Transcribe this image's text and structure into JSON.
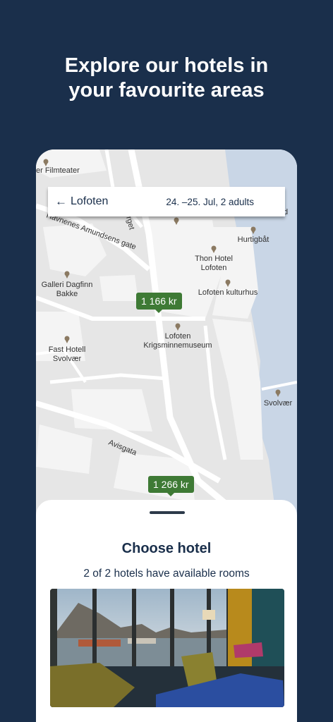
{
  "headline": {
    "line1": "Explore our hotels in",
    "line2": "your favourite areas"
  },
  "search_bar": {
    "back_icon": "arrow-left-icon",
    "location": "Lofoten",
    "dates_guests": "24. –25. Jul, 2 adults"
  },
  "map": {
    "street_labels": [
      "er Filmteater",
      "Havnenes Amundsens gate",
      "rget",
      "Avisgata",
      "d"
    ],
    "poi_labels": [
      "Hurtigbåt",
      "Thon Hotel",
      "Lofoten",
      "Galleri Dagfinn",
      "Bakke",
      "Lofoten kulturhus",
      "Lofoten",
      "Krigsminnemuseum",
      "Fast Hotell",
      "Svolvær",
      "Svolvær"
    ],
    "price_tags": [
      "1 166 kr",
      "1 266 kr"
    ],
    "colors": {
      "land": "#e6e6e6",
      "block": "#f4f4f4",
      "water": "#c9d6e6",
      "road": "#ffffff",
      "pin": "#8b7a62",
      "price_tag": "#3e7a35"
    }
  },
  "sheet": {
    "title": "Choose hotel",
    "subtitle": "2 of 2 hotels have available rooms"
  },
  "colors": {
    "background": "#1a2f4b",
    "accent_text": "#1a2f4b",
    "white": "#ffffff"
  }
}
